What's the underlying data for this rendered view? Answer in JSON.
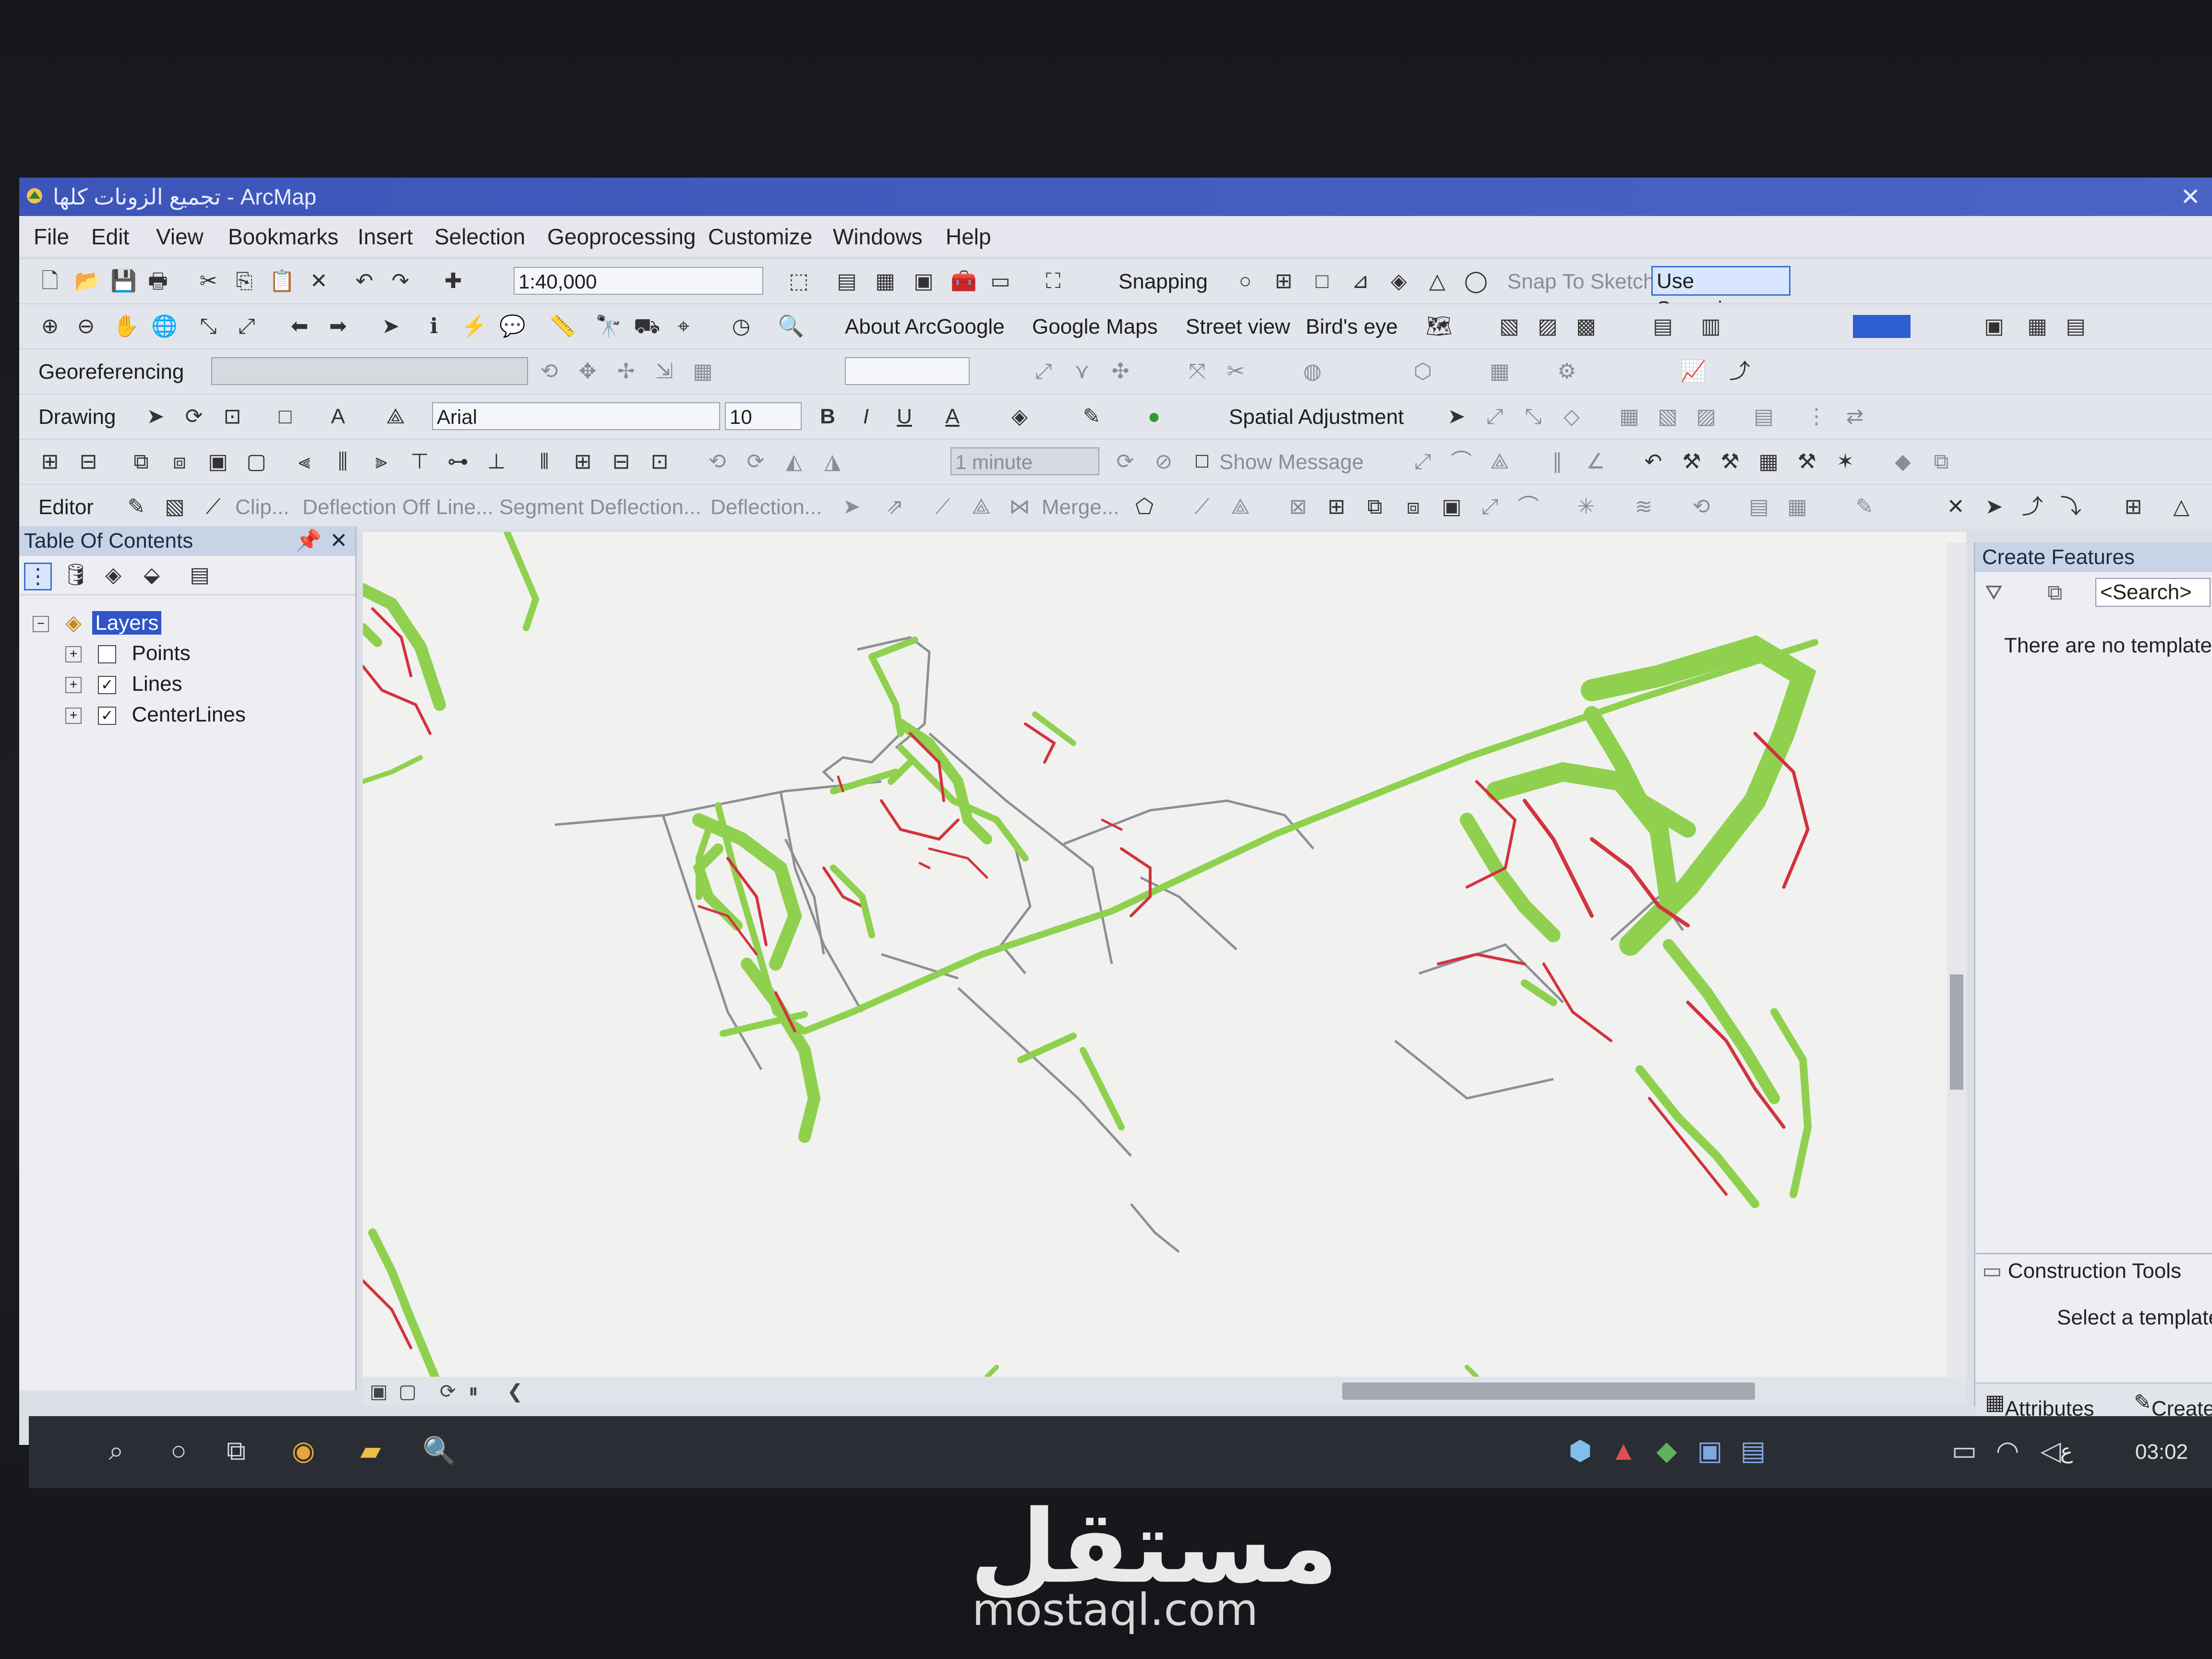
{
  "window": {
    "title": "تجميع الزونات كلها - ArcMap"
  },
  "menu": [
    "File",
    "Edit",
    "View",
    "Bookmarks",
    "Insert",
    "Selection",
    "Geoprocessing",
    "Customize",
    "Windows",
    "Help"
  ],
  "toolbar1": {
    "scale": "1:40,000",
    "snapping_label": "Snapping",
    "snap_to_sketch": "Snap To Sketch",
    "use_snapping": "Use Snapping"
  },
  "toolbar2": {
    "about_arcgoogle": "About ArcGoogle",
    "google_maps": "Google Maps",
    "street_view": "Street view",
    "birds_eye": "Bird's eye"
  },
  "toolbar3": {
    "georeferencing": "Georeferencing"
  },
  "toolbar4": {
    "drawing": "Drawing",
    "font": "Arial",
    "font_size": "10",
    "bold": "B",
    "italic": "I",
    "underline": "U",
    "font_color": "A",
    "spatial_adjustment": "Spatial Adjustment"
  },
  "toolbar5": {
    "interval": "1 minute",
    "show_message": "Show Message"
  },
  "toolbar6": {
    "editor": "Editor",
    "clip": "Clip...",
    "deflection_off_line": "Deflection Off Line...",
    "segment_deflection": "Segment Deflection...",
    "deflection": "Deflection...",
    "merge": "Merge..."
  },
  "toc": {
    "title": "Table Of Contents",
    "pin": "📌",
    "close": "✕",
    "root": "Layers",
    "layers": [
      {
        "name": "Points",
        "checked": false
      },
      {
        "name": "Lines",
        "checked": true
      },
      {
        "name": "CenterLines",
        "checked": true
      }
    ]
  },
  "create_features": {
    "title": "Create Features",
    "search_placeholder": "<Search>",
    "no_templates": "There are no template",
    "construction_tools": "Construction Tools",
    "select_template": "Select a template",
    "tab_attributes": "Attributes",
    "tab_create": "Create"
  },
  "taskbar": {
    "clock": "03:02",
    "lang": "ع"
  },
  "watermark": {
    "arabic": "مستقل",
    "latin": "mostaql.com"
  },
  "colors": {
    "title_bar": "#3d55b8",
    "centerline_green": "#8fd14f",
    "line_red": "#d2333f",
    "line_grey": "#8c8f96",
    "highlight_blue": "#2f55c7"
  }
}
